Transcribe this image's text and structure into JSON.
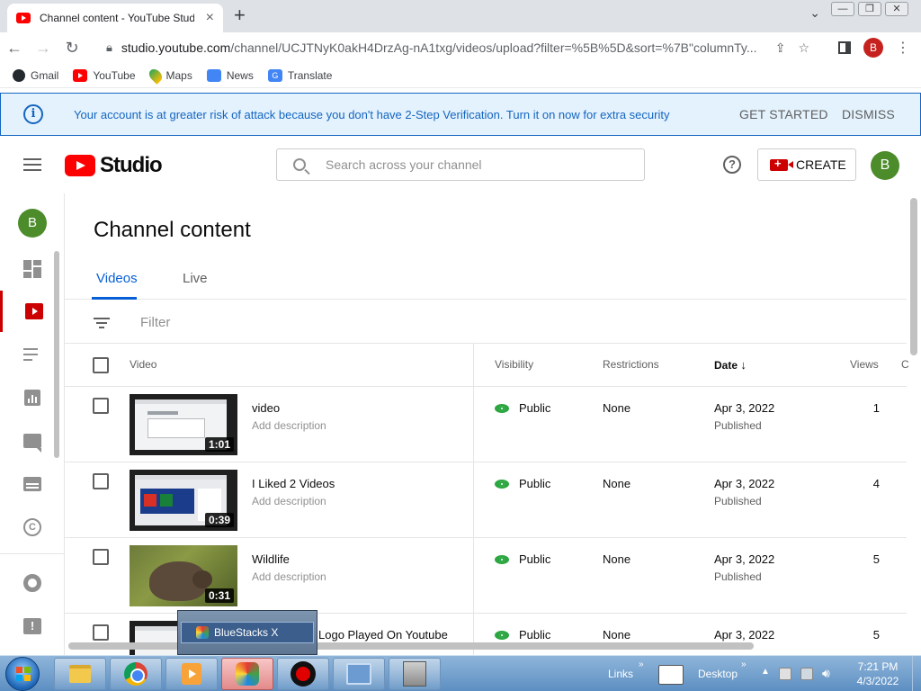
{
  "browser": {
    "tab_title": "Channel content - YouTube Studio",
    "tab_close": "×",
    "new_tab": "+",
    "url_host": "studio.youtube.com",
    "url_path": "/channel/UCJTNyK0akH4DrzAg-nA1txg/videos/upload?filter=%5B%5D&sort=%7B\"columnTy...",
    "profile_initial": "B",
    "bookmarks": [
      {
        "label": "Gmail",
        "icon": "github-icon"
      },
      {
        "label": "YouTube",
        "icon": "youtube-icon"
      },
      {
        "label": "Maps",
        "icon": "maps-icon"
      },
      {
        "label": "News",
        "icon": "news-icon"
      },
      {
        "label": "Translate",
        "icon": "translate-icon"
      }
    ]
  },
  "banner": {
    "message": "Your account is at greater risk of attack because you don't have 2-Step Verification. Turn it on now for extra security",
    "get_started": "GET STARTED",
    "dismiss": "DISMISS",
    "color": "#1565c0"
  },
  "header": {
    "logo_text": "Studio",
    "search_placeholder": "Search across your channel",
    "create_label": "CREATE",
    "avatar_initial": "B"
  },
  "nav": {
    "avatar_initial": "B",
    "accent": "#cc0000"
  },
  "main": {
    "title": "Channel content",
    "tabs": [
      {
        "label": "Videos",
        "active": true
      },
      {
        "label": "Live",
        "active": false
      }
    ],
    "filter_label": "Filter",
    "columns": {
      "video": "Video",
      "visibility": "Visibility",
      "restrictions": "Restrictions",
      "date": "Date",
      "views": "Views",
      "overflow": "C"
    },
    "rows": [
      {
        "title": "video",
        "desc": "Add description",
        "duration": "1:01",
        "visibility": "Public",
        "restrictions": "None",
        "date": "Apr 3, 2022",
        "status": "Published",
        "views": "1"
      },
      {
        "title": "I Liked 2 Videos",
        "desc": "Add description",
        "duration": "0:39",
        "visibility": "Public",
        "restrictions": "None",
        "date": "Apr 3, 2022",
        "status": "Published",
        "views": "4"
      },
      {
        "title": "Wildlife",
        "desc": "Add description",
        "duration": "0:31",
        "visibility": "Public",
        "restrictions": "None",
        "date": "Apr 3, 2022",
        "status": "Published",
        "views": "5"
      },
      {
        "title": "Logo Played On Youtube",
        "visibility": "Public",
        "restrictions": "None",
        "date": "Apr 3, 2022",
        "views": "5"
      }
    ]
  },
  "popup": {
    "label": "BlueStacks X"
  },
  "taskbar": {
    "links": "Links",
    "desktop": "Desktop",
    "time": "7:21 PM",
    "date": "4/3/2022"
  }
}
